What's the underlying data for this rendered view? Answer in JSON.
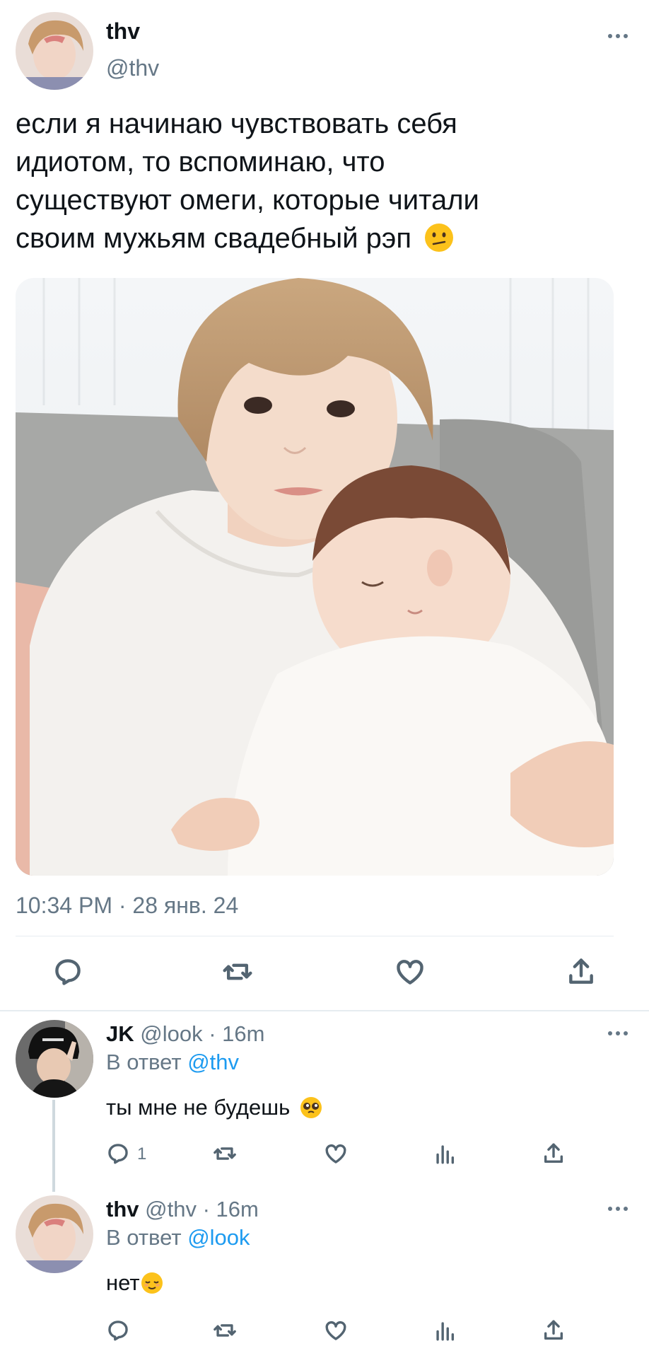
{
  "tweet": {
    "display_name": "thv",
    "handle": "@thv",
    "text_lines": [
      "если я начинаю чувствовать себя",
      "идиотом, то вспоминаю, что",
      "существуют омеги, которые читали",
      "своим мужьям свадебный рэп"
    ],
    "emoji": "confused-face-emoji",
    "timestamp": "10:34 PM · 28 янв. 24",
    "media_icon": "photo-man-holding-sleeping-baby"
  },
  "replies": [
    {
      "display_name": "JK",
      "handle": "@look",
      "time": "· 16m",
      "reply_prefix": "В ответ",
      "reply_to": "@thv",
      "text": "ты мне не будешь",
      "emoji": "pleading-face-emoji",
      "reply_count": "1"
    },
    {
      "display_name": "thv",
      "handle": "@thv",
      "time": "· 16m",
      "reply_prefix": "В ответ",
      "reply_to": "@look",
      "text": "нет",
      "emoji": "relieved-face-emoji",
      "reply_count": ""
    }
  ],
  "colors": {
    "link": "#1d9bf0",
    "muted": "#657786",
    "divider": "#e6ecf0"
  }
}
